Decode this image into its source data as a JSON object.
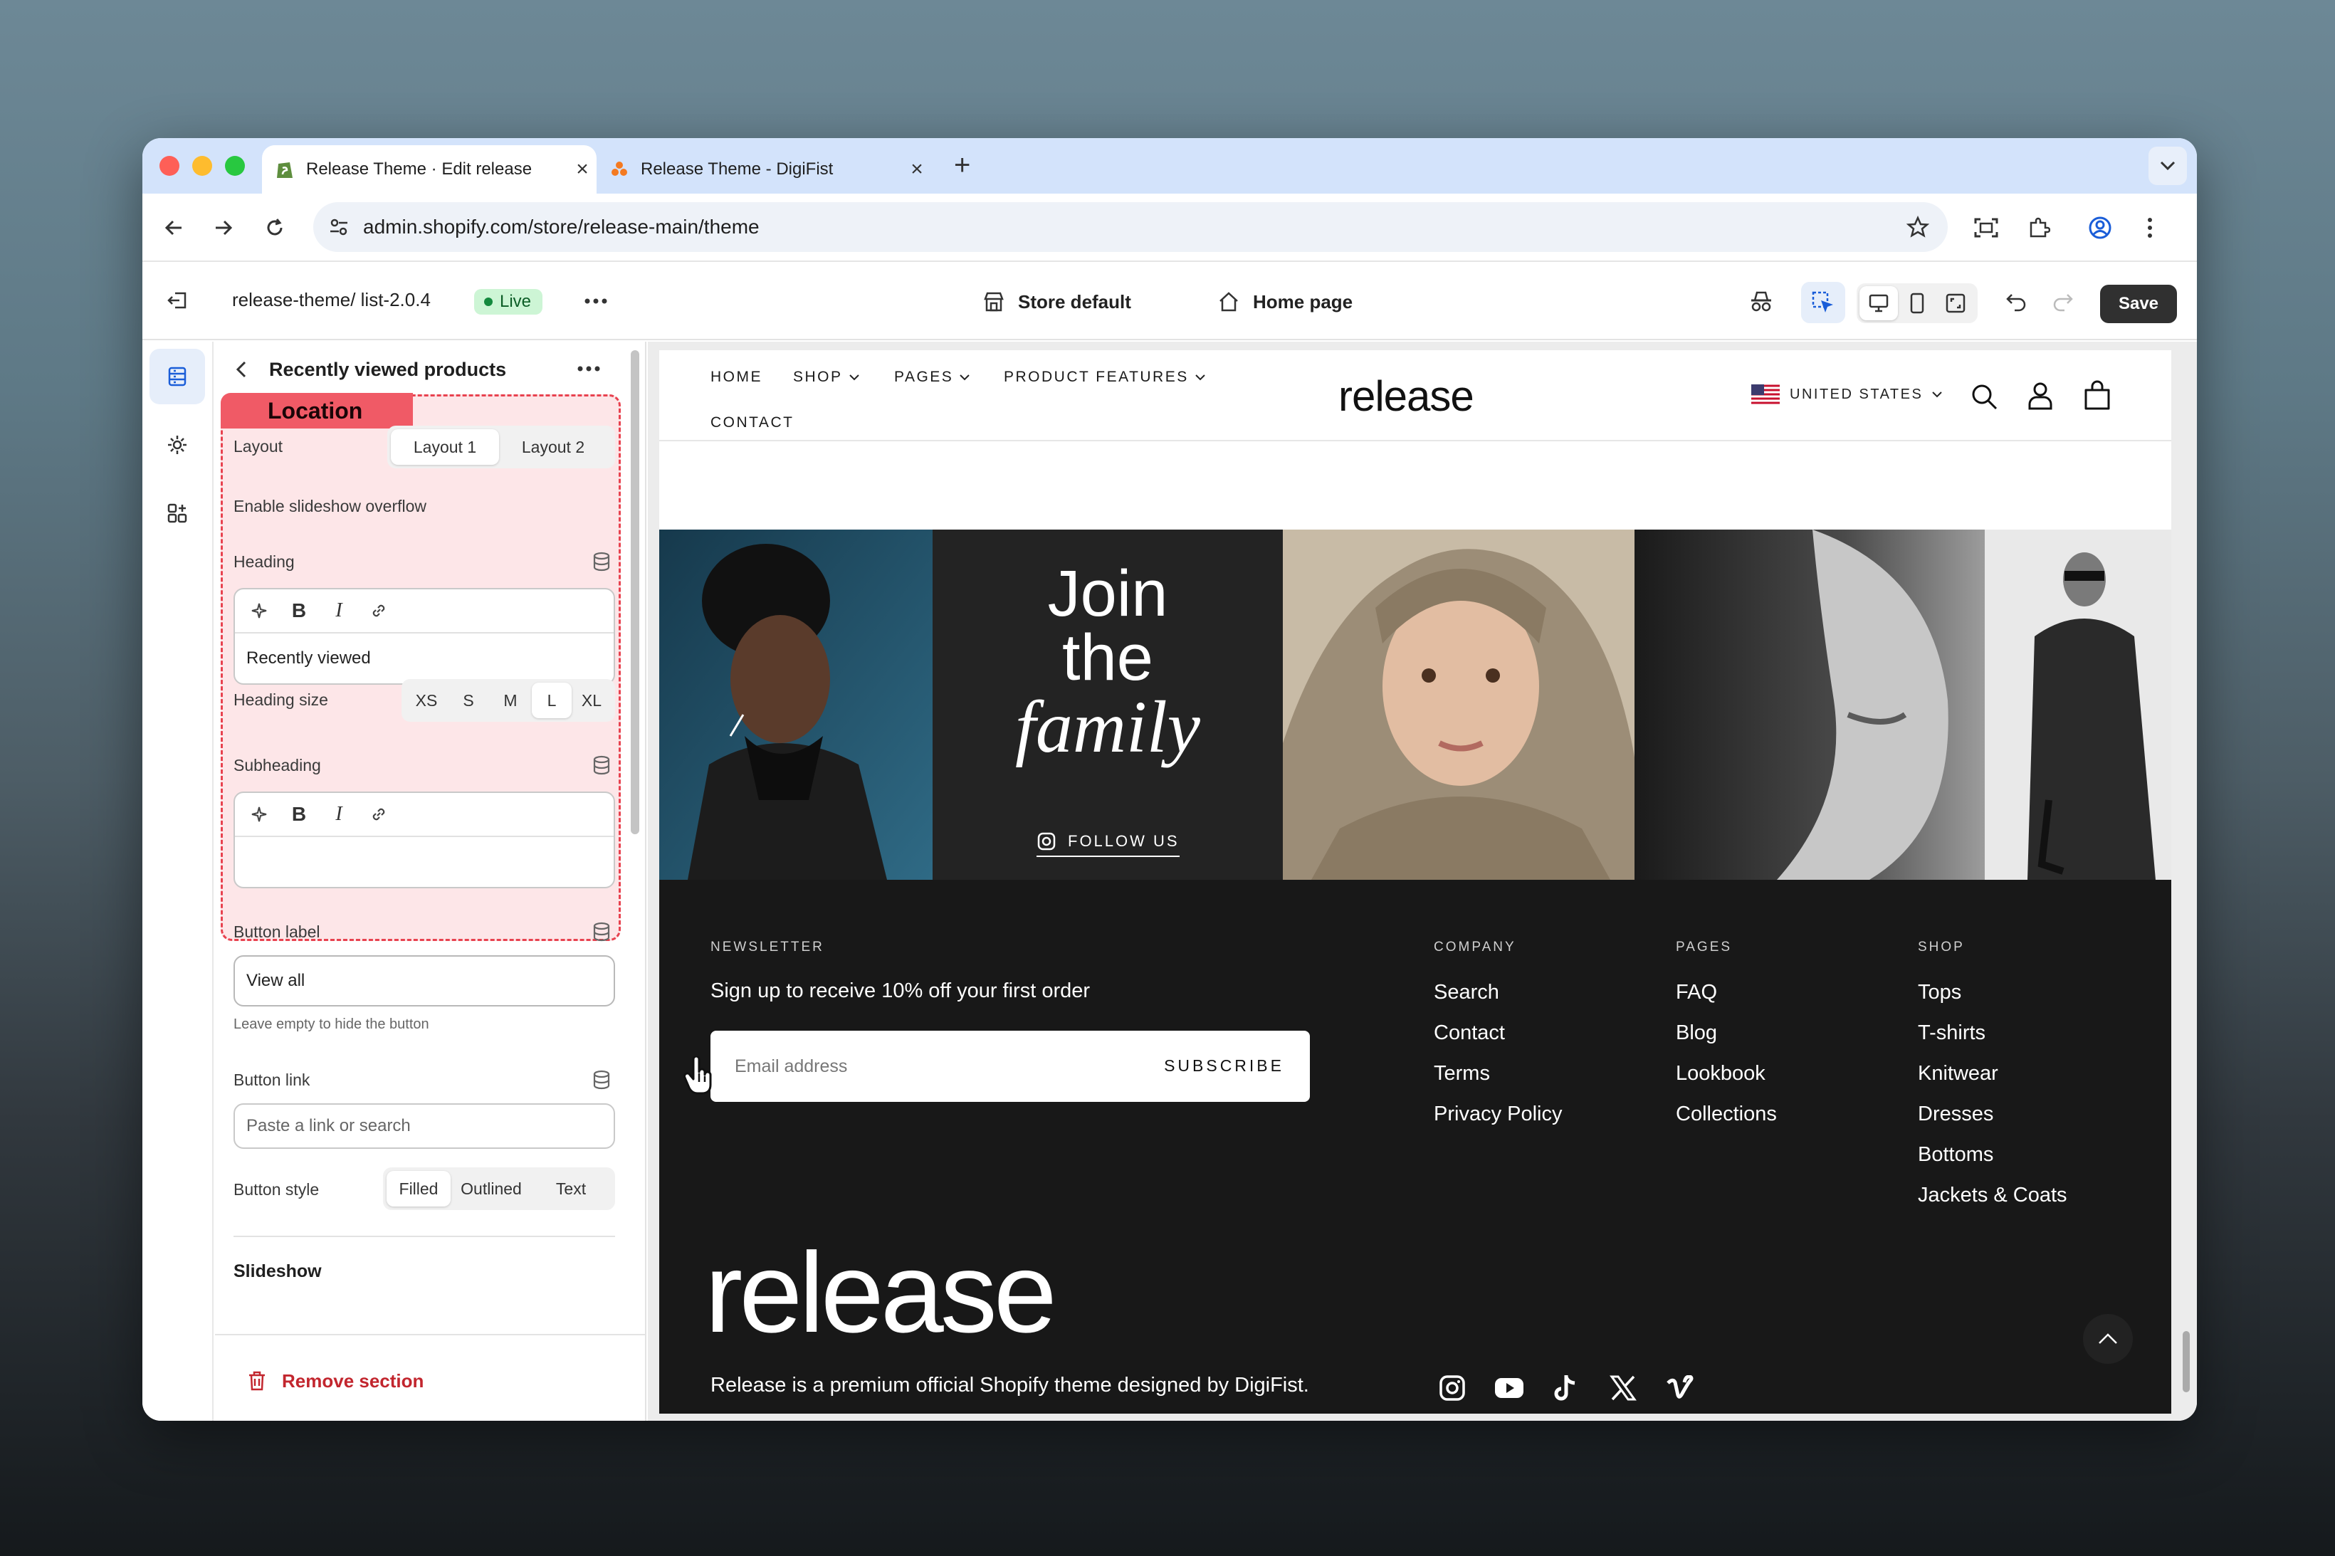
{
  "browser": {
    "tabs": [
      {
        "title": "Release Theme · Edit release",
        "active": true
      },
      {
        "title": "Release Theme - DigiFist",
        "active": false
      }
    ],
    "url": "admin.shopify.com/store/release-main/theme"
  },
  "editor": {
    "theme_path": "release-theme/ list-2.0.4",
    "status": "Live",
    "template": "Store default",
    "page": "Home page",
    "save": "Save"
  },
  "panel": {
    "title": "Recently viewed products",
    "highlight_label": "Location",
    "layout": {
      "label": "Layout",
      "options": [
        "Layout 1",
        "Layout 2"
      ],
      "selected": "Layout 1"
    },
    "slideshow_overflow": {
      "label": "Enable slideshow overflow",
      "enabled": false
    },
    "heading": {
      "label": "Heading",
      "value": "Recently viewed"
    },
    "heading_size": {
      "label": "Heading size",
      "options": [
        "XS",
        "S",
        "M",
        "L",
        "XL"
      ],
      "selected": "L"
    },
    "subheading": {
      "label": "Subheading",
      "value": ""
    },
    "button_label": {
      "label": "Button label",
      "value": "View all",
      "hint": "Leave empty to hide the button"
    },
    "button_link": {
      "label": "Button link",
      "placeholder": "Paste a link or search"
    },
    "button_style": {
      "label": "Button style",
      "options": [
        "Filled",
        "Outlined",
        "Text"
      ],
      "selected": "Filled"
    },
    "slideshow": "Slideshow",
    "remove": "Remove section"
  },
  "site": {
    "nav": [
      "HOME",
      "SHOP",
      "PAGES",
      "PRODUCT FEATURES",
      "CONTACT"
    ],
    "logo": "release",
    "country": "UNITED STATES",
    "banner": {
      "line1": "Join",
      "line2": "the",
      "line3": "family",
      "follow": "FOLLOW US"
    },
    "footer": {
      "newsletter_heading": "NEWSLETTER",
      "newsletter_text": "Sign up to receive 10% off your first order",
      "email_placeholder": "Email address",
      "subscribe": "SUBSCRIBE",
      "columns": [
        {
          "heading": "COMPANY",
          "links": [
            "Search",
            "Contact",
            "Terms",
            "Privacy Policy"
          ]
        },
        {
          "heading": "PAGES",
          "links": [
            "FAQ",
            "Blog",
            "Lookbook",
            "Collections"
          ]
        },
        {
          "heading": "SHOP",
          "links": [
            "Tops",
            "T-shirts",
            "Knitwear",
            "Dresses",
            "Bottoms",
            "Jackets & Coats"
          ]
        }
      ],
      "big_logo": "release",
      "tagline": "Release is a premium official Shopify theme designed by DigiFist."
    }
  },
  "colors": {
    "accent": "#e8424f",
    "highlight_bg": "#fde6e8",
    "live_bg": "#cdf5d5",
    "save_bg": "#303030"
  }
}
